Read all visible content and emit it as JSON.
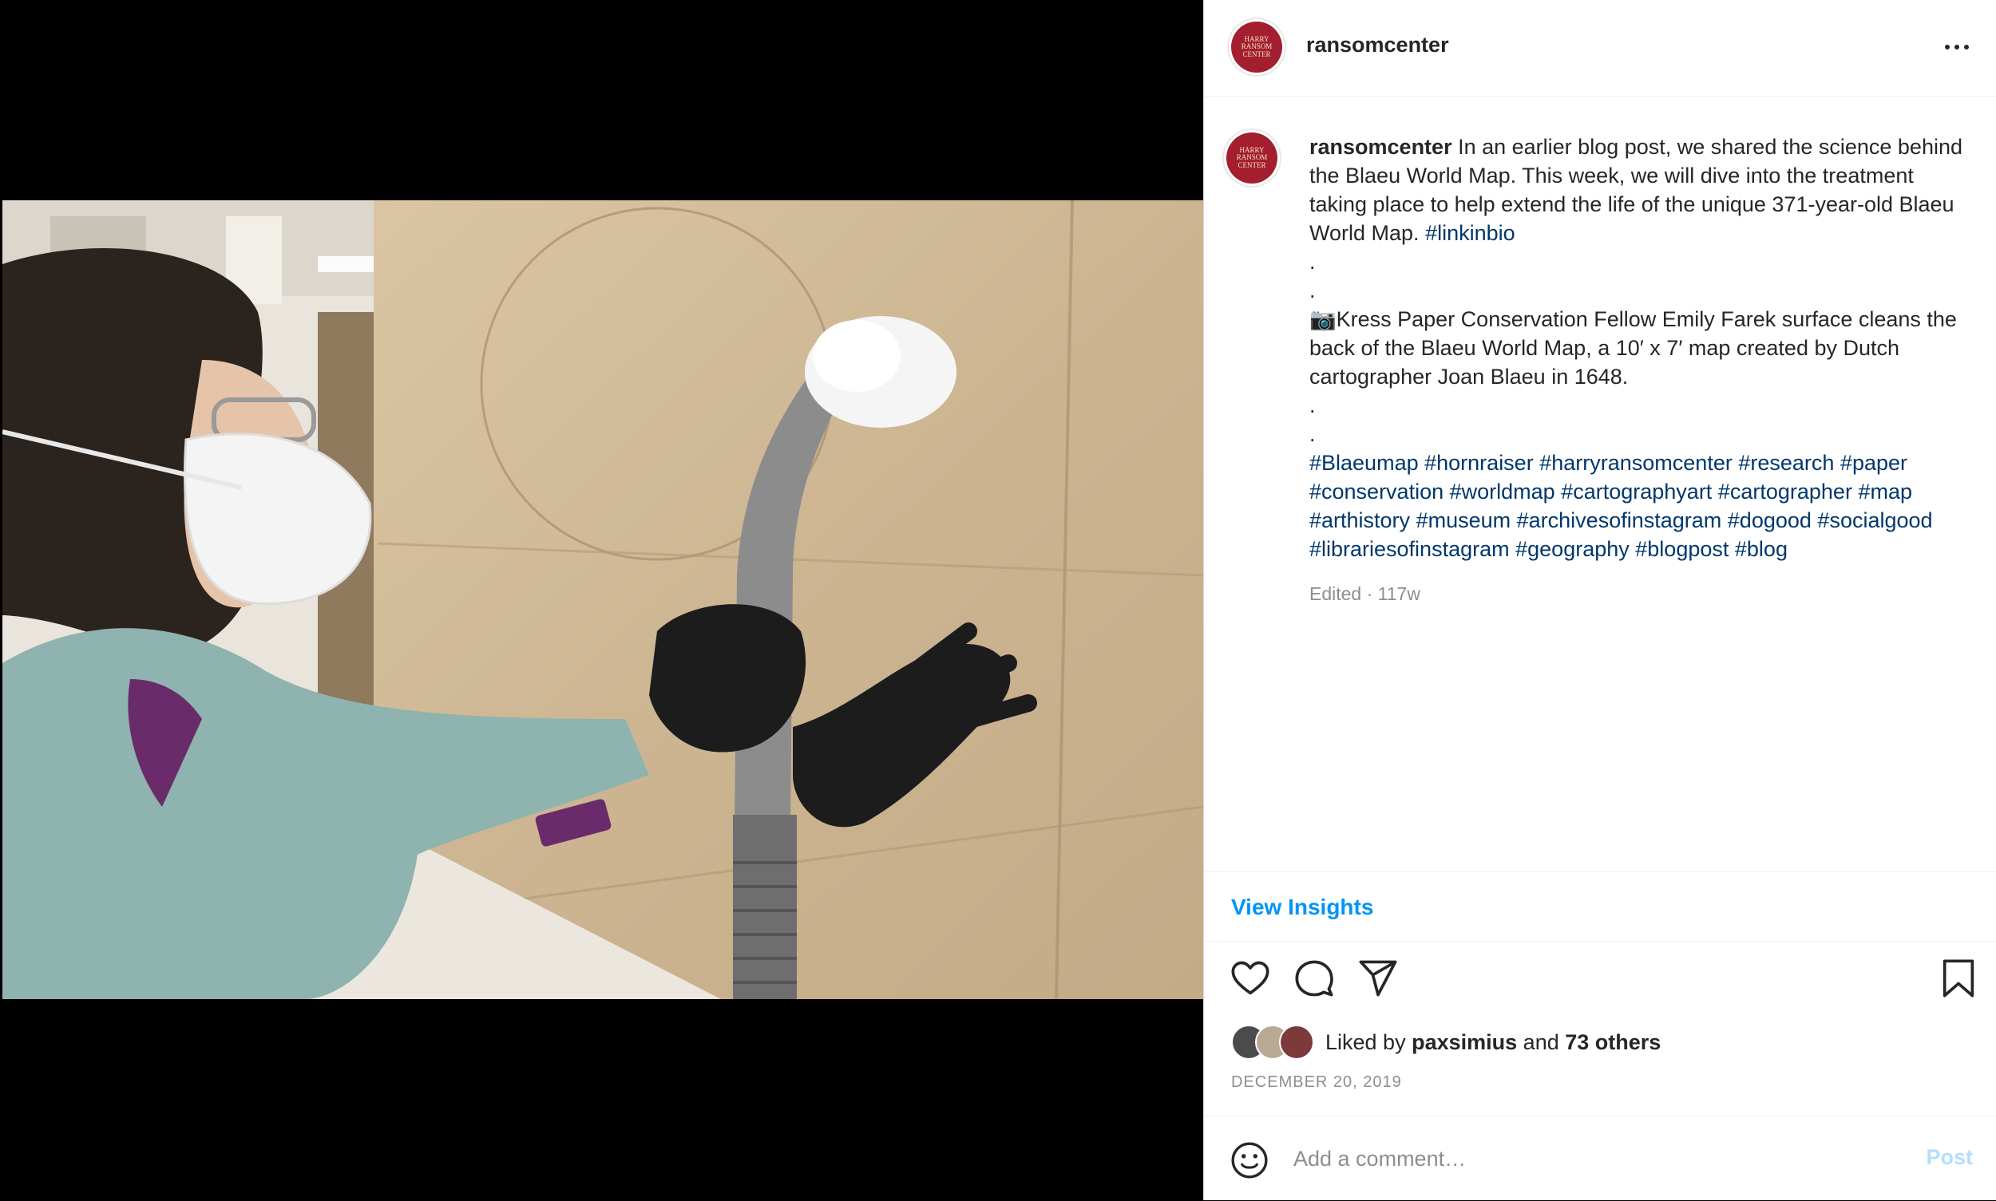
{
  "post": {
    "username": "ransomcenter",
    "avatar_text": [
      "HARRY",
      "RANSOM",
      "CENTER"
    ],
    "caption_intro": "In an earlier blog post, we shared the science behind the Blaeu World Map. This week, we will dive into the treatment taking place to help extend the life of the unique 371-year-old Blaeu World Map.",
    "caption_intro_tag": "#linkinbio",
    "dot": ".",
    "caption_body": "📷Kress Paper Conservation Fellow Emily Farek surface cleans the back of the Blaeu World Map, a 10′ x 7′ map created by Dutch cartographer Joan Blaeu in 1648.",
    "hashtags": [
      "#Blaeumap",
      "#hornraiser",
      "#harryransomcenter",
      "#research",
      "#paper",
      "#conservation",
      "#worldmap",
      "#cartographyart",
      "#cartographer",
      "#map",
      "#arthistory",
      "#museum",
      "#archivesofinstagram",
      "#dogood",
      "#socialgood",
      "#librariesofinstagram",
      "#geography",
      "#blogpost",
      "#blog"
    ],
    "edited_label": "Edited · 117w",
    "view_insights": "View Insights",
    "liked_by_prefix": "Liked by",
    "liked_by_user": "paxsimius",
    "liked_by_and": "and",
    "liked_by_others": "73 others",
    "date": "DECEMBER 20, 2019",
    "comment_placeholder": "Add a comment…",
    "post_button": "Post"
  },
  "icons": {
    "header_more": "more-horizontal-icon",
    "like": "heart-icon",
    "comment": "comment-bubble-icon",
    "share": "paper-plane-icon",
    "save": "bookmark-icon",
    "emoji": "emoji-smile-icon"
  },
  "colors": {
    "link_blue": "#0095f6",
    "hashtag": "#00376b",
    "avatar_red": "#a31f2f",
    "muted": "#8e8e8e",
    "post_disabled": "#b2dffc"
  }
}
